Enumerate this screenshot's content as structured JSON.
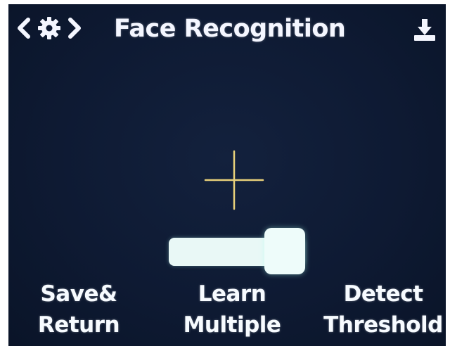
{
  "header": {
    "title": "Face Recognition",
    "left_icon": "chevron-left-gear-chevron-right-icon",
    "right_icon": "download-icon"
  },
  "center": {
    "reticle_icon": "crosshair-icon",
    "slider": {
      "name": "learn-multiple-toggle",
      "state": "on",
      "value": 1.0
    }
  },
  "buttons": {
    "save_line1": "Save&",
    "save_line2": "Return",
    "learn_line1": "Learn",
    "learn_line2": "Multiple",
    "detect_line1": "Detect",
    "detect_line2": "Threshold"
  },
  "colors": {
    "background": "#0e1a33",
    "text": "#f4f6ff",
    "crosshair": "#e8d07a",
    "slider": "#e9f8f6"
  }
}
